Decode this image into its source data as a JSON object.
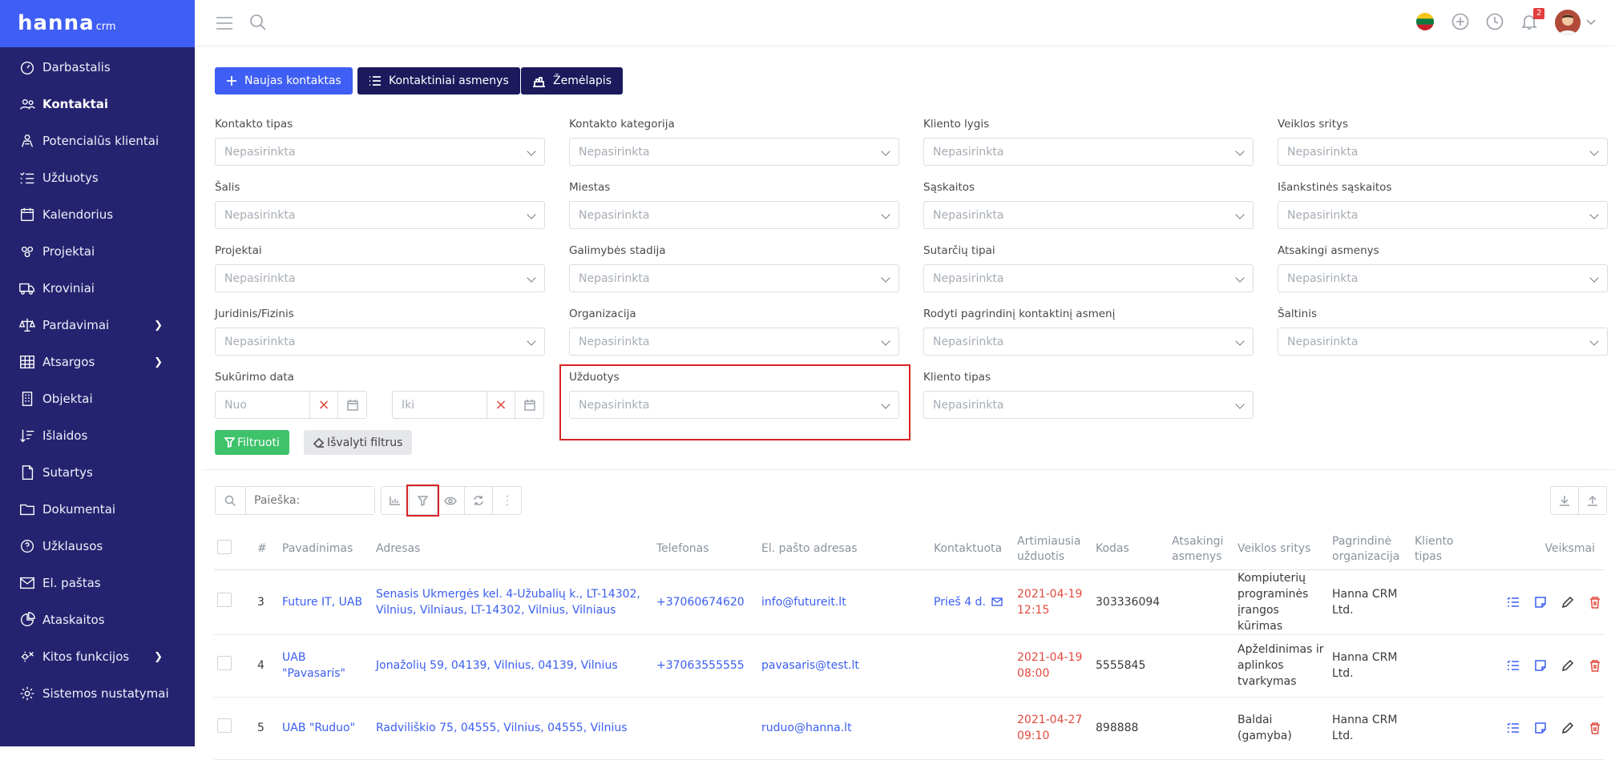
{
  "brand": {
    "name": "hanna",
    "suffix": "crm"
  },
  "sidebar": {
    "items": [
      {
        "label": "Darbastalis",
        "icon": "dashboard-icon"
      },
      {
        "label": "Kontaktai",
        "icon": "users-icon"
      },
      {
        "label": "Potencialūs klientai",
        "icon": "leads-icon"
      },
      {
        "label": "Užduotys",
        "icon": "tasks-icon"
      },
      {
        "label": "Kalendorius",
        "icon": "calendar-icon"
      },
      {
        "label": "Projektai",
        "icon": "projects-icon"
      },
      {
        "label": "Kroviniai",
        "icon": "truck-icon"
      },
      {
        "label": "Pardavimai",
        "icon": "scales-icon"
      },
      {
        "label": "Atsargos",
        "icon": "grid-icon"
      },
      {
        "label": "Objektai",
        "icon": "building-icon"
      },
      {
        "label": "Išlaidos",
        "icon": "sort-icon"
      },
      {
        "label": "Sutartys",
        "icon": "document-icon"
      },
      {
        "label": "Dokumentai",
        "icon": "folder-icon"
      },
      {
        "label": "Užklausos",
        "icon": "inquiry-icon"
      },
      {
        "label": "El. paštas",
        "icon": "mail-icon"
      },
      {
        "label": "Ataskaitos",
        "icon": "pie-icon"
      },
      {
        "label": "Kitos funkcijos",
        "icon": "settings-icon"
      },
      {
        "label": "Sistemos nustatymai",
        "icon": "gear-icon"
      }
    ]
  },
  "topbar": {
    "notifications_count": "2"
  },
  "actions": {
    "new_contact": "Naujas kontaktas",
    "contact_persons": "Kontaktiniai asmenys",
    "map": "Žemėlapis"
  },
  "filters": {
    "placeholder": "Nepasirinkta",
    "labels": [
      "Kontakto tipas",
      "Kontakto kategorija",
      "Kliento lygis",
      "Veiklos sritys",
      "Šalis",
      "Miestas",
      "Sąskaitos",
      "Išankstinės sąskaitos",
      "Projektai",
      "Galimybės stadija",
      "Sutarčių tipai",
      "Atsakingi asmenys",
      "Juridinis/Fizinis",
      "Organizacija",
      "Rodyti pagrindinį kontaktinį asmenį",
      "Šaltinis"
    ],
    "created_label": "Sukūrimo data",
    "from": "Nuo",
    "to": "Iki",
    "tasks_label": "Užduotys",
    "client_type_label": "Kliento tipas",
    "filter_btn": "Filtruoti",
    "clear_btn": "Išvalyti filtrus"
  },
  "search": {
    "placeholder": "Paieška:"
  },
  "table": {
    "headers": [
      "#",
      "Pavadinimas",
      "Adresas",
      "Telefonas",
      "El. pašto adresas",
      "Kontaktuota",
      "Artimiausia užduotis",
      "Kodas",
      "Atsakingi asmenys",
      "Veiklos sritys",
      "Pagrindinė organizacija",
      "Kliento tipas",
      "Veiksmai"
    ],
    "rows": [
      {
        "num": "3",
        "name": "Future IT, UAB",
        "address": "Senasis Ukmergės kel. 4-Užubalių k., LT-14302, Vilnius, Vilniaus, LT-14302, Vilnius, Vilniaus",
        "phone": "+37060674620",
        "email": "info@futureit.lt",
        "contacted": "Prieš 4 d.",
        "task_date": "2021-04-19",
        "task_time": "12:15",
        "code": "303336094",
        "area": "Kompiuterių programinės įrangos kūrimas",
        "org": "Hanna CRM Ltd."
      },
      {
        "num": "4",
        "name": "UAB \"Pavasaris\"",
        "address": "Jonažolių 59, 04139, Vilnius, 04139, Vilnius",
        "phone": "+37063555555",
        "email": "pavasaris@test.lt",
        "contacted": "",
        "task_date": "2021-04-19",
        "task_time": "08:00",
        "code": "5555845",
        "area": "Apželdinimas ir aplinkos tvarkymas",
        "org": "Hanna CRM Ltd."
      },
      {
        "num": "5",
        "name": "UAB \"Ruduo\"",
        "address": "Radviliškio 75, 04555, Vilnius, 04555, Vilnius",
        "phone": "",
        "email": "ruduo@hanna.lt",
        "contacted": "",
        "task_date": "2021-04-27",
        "task_time": "09:10",
        "code": "898888",
        "area": "Baldai (gamyba)",
        "org": "Hanna CRM Ltd."
      }
    ]
  },
  "colors": {
    "sidebar": "#25236f",
    "logo_bar": "#3f5ef3",
    "primary": "#3f5ef3",
    "dark": "#1c1a5c",
    "success": "#3ec26a",
    "link": "#3a5ef0",
    "danger": "#e04a3e",
    "highlight": "#d82323"
  }
}
